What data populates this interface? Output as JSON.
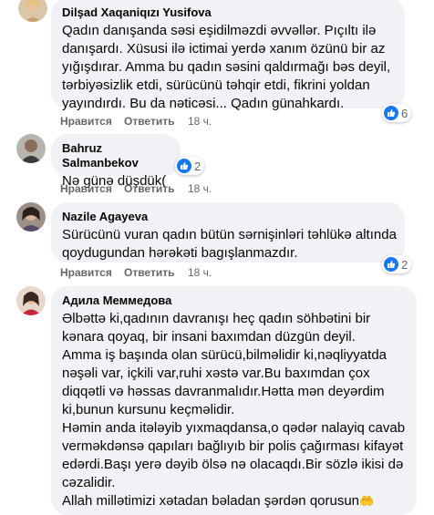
{
  "comments": [
    {
      "author": "Dilşad Xaqaniqızı Yusifova",
      "lines": [
        "Qadın danışanda səsi eşidilməzdi əvvəllər. Pıçıltı ilə",
        "danışardı. Xüsusi ilə ictimai yerdə xanım özünü bir az",
        "yığışdırar. Amma bu qadın səsini qaldırmağı bəs deyil,",
        "tərbiyəsizlik etdi, sürücünü təhqir etdi, fikrini yoldan",
        "yayındırdı. Bu da nəticəsi... Qadın günahkardı."
      ],
      "like_label": "Нравится",
      "reply_label": "Ответить",
      "time": "18 ч.",
      "reactions_count": "6"
    },
    {
      "author": "Bahruz Salmanbekov",
      "lines": [
        "Nə günə düşdük("
      ],
      "like_label": "Нравится",
      "reply_label": "Ответить",
      "time": "18 ч.",
      "reactions_count": "2"
    },
    {
      "author": "Nazile Agayeva",
      "lines": [
        "Sürücünü vuran qadın bütün sərnişinləri təhlükə altında",
        "qoydugundan hərəkəti bagışlanmazdır."
      ],
      "like_label": "Нравится",
      "reply_label": "Ответить",
      "time": "18 ч.",
      "reactions_count": "2"
    },
    {
      "author": "Адила Меммедова",
      "lines": [
        "Əlbəttə ki,qadının davranışı heç qadın söhbətini bir",
        "kənara qoyaq, bir insani baxımdan düzgün deyil.",
        "Amma iş başında olan sürücü,bilməlidir ki,nəqliyyatda",
        "nəşəli var, içkili var,ruhi xəstə var.Bu baxımdan çox",
        "diqqətli və həssas davranmalıdır.Hətta mən deyərdim",
        "ki,bunun kursunu keçməlidir.",
        "Həmin anda itələyib yıxmaqdansa,o qədər nalayiq cavab",
        "verməkdənsə qapıları bağlıyıb bir polis çağırması kifayət",
        "edərdi.Başı yerə dəyib ölsə nə olacaqdı.Bir sözlə ikisi də",
        "cəzalidir.",
        "Allah millətimizi xətadan bəladan şərdən qorusun"
      ],
      "emoji": "🤲"
    }
  ],
  "colors": {
    "bubble": "#f0f2f5",
    "like_blue": "#1877f2",
    "meta_gray": "#65676b"
  }
}
